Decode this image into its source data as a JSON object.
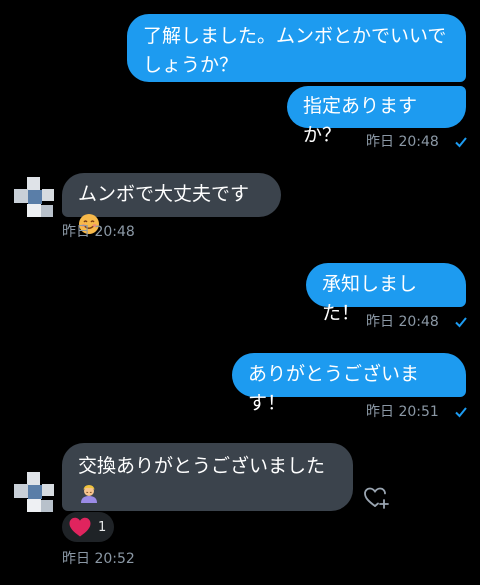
{
  "messages": [
    {
      "text": "了解しました。ムンボとかでいいでしょうか？"
    },
    {
      "text": "指定ありますか？"
    },
    {
      "time": "昨日 20:48"
    },
    {
      "text": "ムンボで大丈夫です",
      "emoji": "smiling-face-icon",
      "time": "昨日 20:48"
    },
    {
      "text": "承知しました！",
      "time": "昨日 20:48"
    },
    {
      "text": "ありがとうございます！",
      "time": "昨日 20:51"
    },
    {
      "text": "交換ありがとうございました",
      "emoji": "person-bowing-icon",
      "time": "昨日 20:52",
      "reaction_count": "1"
    }
  ],
  "colors": {
    "sent_bubble": "#1d9bf0",
    "received_bubble": "#3b434c",
    "meta_text": "#8b98a5",
    "heart": "#e0245e"
  }
}
